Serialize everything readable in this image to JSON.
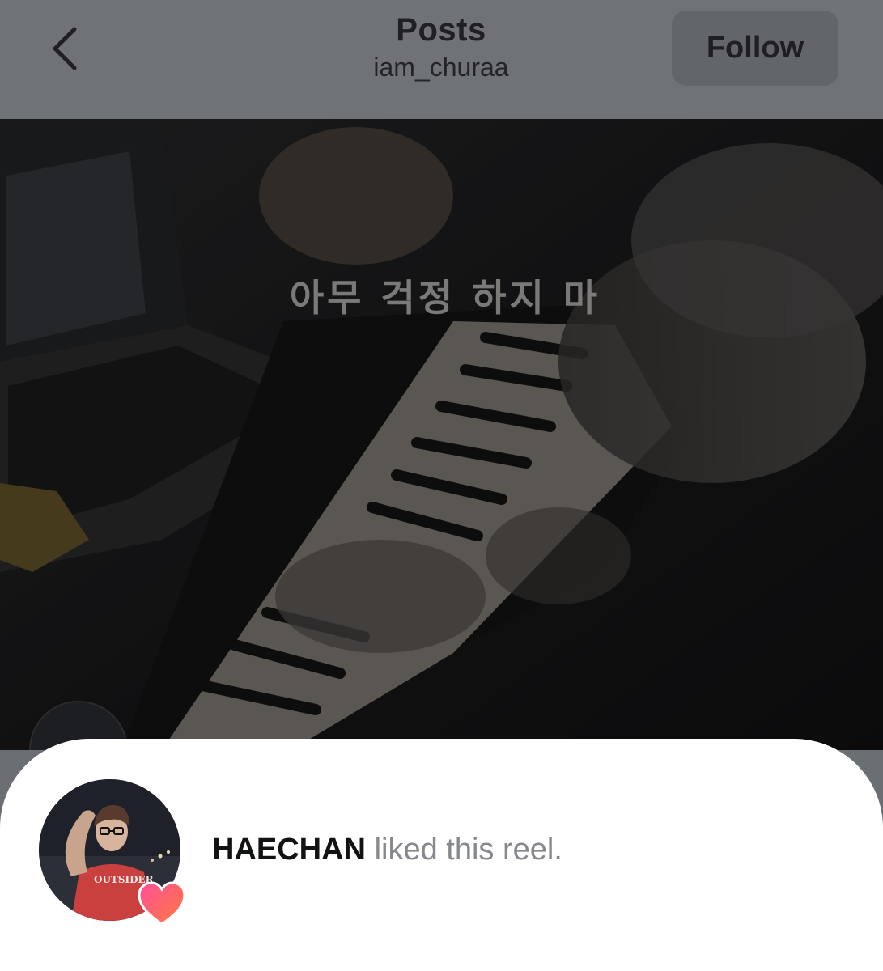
{
  "header": {
    "title": "Posts",
    "username": "iam_churaa",
    "follow_label": "Follow",
    "back_icon": "chevron-left-icon"
  },
  "video": {
    "subtitle": "아무 걱정 하지 마"
  },
  "notification": {
    "user_name": "HAECHAN",
    "action": "liked this reel.",
    "avatar_shirt_text": "OUTSIDER",
    "badge_icon": "heart-icon",
    "heart_color": "#ff5a7a"
  }
}
